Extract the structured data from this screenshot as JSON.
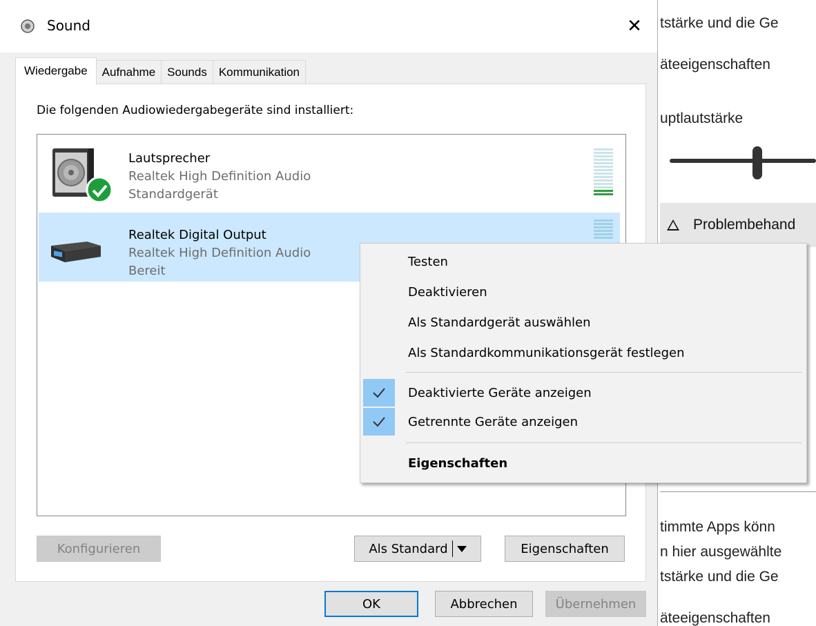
{
  "background_window": {
    "line1": "tstärke und die Ge",
    "line2": "äteeigenschaften",
    "heading": "uptlautstärke",
    "problem": "Problembehand",
    "line_apps1": "timmte Apps könn",
    "line_apps2": "n hier ausgewählte",
    "line_apps3": "tstärke und die Ge",
    "line_bottom": "äteeigenschaften"
  },
  "dialog": {
    "title": "Sound",
    "close_glyph": "✕",
    "tabs": [
      {
        "label": "Wiedergabe",
        "active": true
      },
      {
        "label": "Aufnahme",
        "active": false
      },
      {
        "label": "Sounds",
        "active": false
      },
      {
        "label": "Kommunikation",
        "active": false
      }
    ],
    "heading": "Die folgenden Audiowiedergabegeräte sind installiert:",
    "devices": [
      {
        "name": "Lautsprecher",
        "desc": "Realtek High Definition Audio",
        "status": "Standardgerät",
        "icon": "speaker-icon",
        "badge": "default-check-icon",
        "selected": false
      },
      {
        "name": "Realtek Digital Output",
        "desc": "Realtek High Definition Audio",
        "status": "Bereit",
        "icon": "digital-output-icon",
        "selected": true
      }
    ],
    "buttons": {
      "configure": "Konfigurieren",
      "set_default": "Als Standard",
      "properties": "Eigenschaften",
      "ok": "OK",
      "cancel": "Abbrechen",
      "apply": "Übernehmen"
    }
  },
  "context_menu": {
    "items": [
      {
        "label": "Testen",
        "checked": false,
        "bold": false
      },
      {
        "label": "Deaktivieren",
        "checked": false,
        "bold": false
      },
      {
        "label": "Als Standardgerät auswählen",
        "checked": false,
        "bold": false
      },
      {
        "label": "Als Standardkommunikationsgerät festlegen",
        "checked": false,
        "bold": false
      },
      {
        "label": "Deaktivierte Geräte anzeigen",
        "checked": true,
        "bold": false
      },
      {
        "label": "Getrennte Geräte anzeigen",
        "checked": true,
        "bold": false
      },
      {
        "label": "Eigenschaften",
        "checked": false,
        "bold": true
      }
    ],
    "check_glyph": "✓"
  },
  "colors": {
    "selection": "#cce8ff",
    "accent": "#0078d7",
    "check_bg": "#90c8f6",
    "default_badge": "#1e9e3a"
  }
}
